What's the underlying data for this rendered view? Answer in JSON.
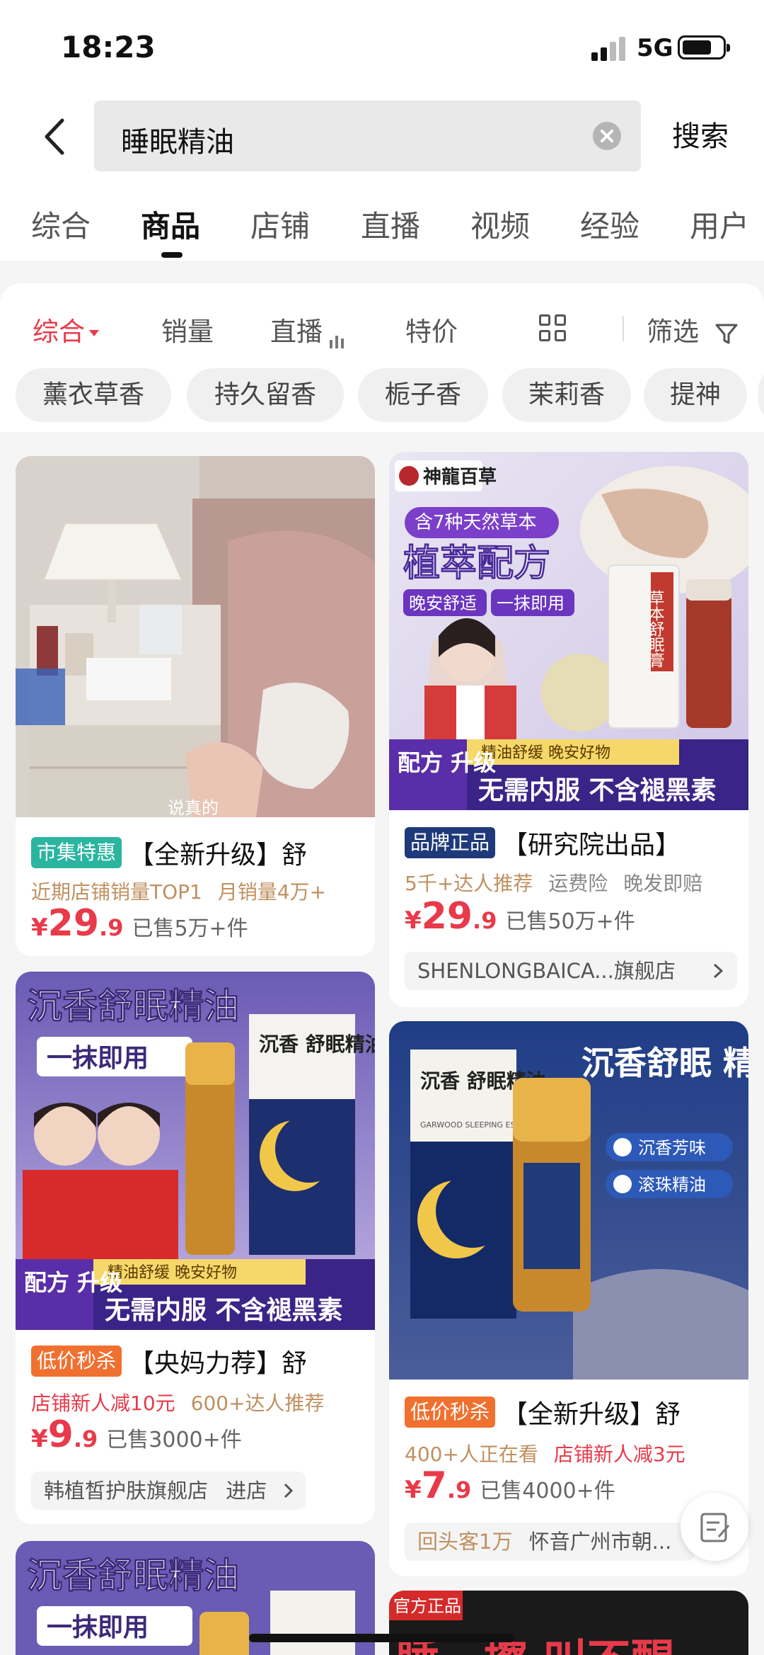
{
  "status_bar": {
    "time": "18:23",
    "network": "5G"
  },
  "search": {
    "query": "睡眠精油",
    "search_button": "搜索"
  },
  "main_tabs": [
    "综合",
    "商品",
    "店铺",
    "直播",
    "视频",
    "经验",
    "用户"
  ],
  "active_main_tab": "商品",
  "sort_bar": {
    "comprehensive": "综合",
    "sales": "销量",
    "live": "直播",
    "special_price": "特价",
    "filter": "筛选"
  },
  "chips": [
    "薰衣草香",
    "持久留香",
    "栀子香",
    "茉莉香",
    "提神"
  ],
  "colors": {
    "accent_red": "#e83a4a",
    "badge_green": "#2bb5a0",
    "badge_navy": "#1f3a7a",
    "badge_orange": "#f07030"
  },
  "products": [
    {
      "badge": "市集特惠",
      "title": "【全新升级】舒",
      "info": [
        "近期店铺销量TOP1",
        "月销量4万+"
      ],
      "price_int": "29",
      "price_dec": ".9",
      "currency": "¥",
      "sold": "已售5万+件",
      "image_caption": "说真的"
    },
    {
      "badge": "品牌正品",
      "title": "【研究院出品】",
      "info": [
        "5千+达人推荐",
        "运费险",
        "晚发即赔"
      ],
      "price_int": "29",
      "price_dec": ".9",
      "currency": "¥",
      "sold": "已售50万+件",
      "store": "SHENLONGBAICA...旗舰店",
      "image": {
        "brand": "神龍百草",
        "pill": "含7种天然草本",
        "headline": "植萃配方",
        "tags": [
          "晚安舒适",
          "一抹即用"
        ],
        "product_name": "草本舒眠膏",
        "band_small": "精油舒缓 晚安好物",
        "band_left": "配方 升级",
        "band_right": "无需内服 不含褪黑素"
      }
    },
    {
      "badge": "低价秒杀",
      "title": "【央妈力荐】舒",
      "info": [
        "店铺新人减10元",
        "600+达人推荐"
      ],
      "price_int": "9",
      "price_dec": ".9",
      "currency": "¥",
      "sold": "已售3000+件",
      "store": "韩植皙护肤旗舰店",
      "store_action": "进店",
      "image": {
        "headline": "沉香舒眠精油",
        "pill": "一抹即用",
        "box_name": "沉香 舒眠精油",
        "band_small": "精油舒缓 晚安好物",
        "band_left": "配方 升级",
        "band_right": "无需内服 不含褪黑素"
      }
    },
    {
      "badge": "低价秒杀",
      "title": "【全新升级】舒",
      "info": [
        "400+人正在看",
        "店铺新人减3元"
      ],
      "price_int": "7",
      "price_dec": ".9",
      "currency": "¥",
      "sold": "已售4000+件",
      "store": "回头客1万",
      "store_extra": "怀音广州市朝...",
      "image": {
        "headline": "沉香舒眠 精油",
        "box_name": "沉香 舒眠精油",
        "box_sub": "GARWOOD SLEEPING ESSENTIAL OIL",
        "checks": [
          "沉香芳味",
          "滚珠精油"
        ]
      }
    },
    {
      "image": {
        "headline": "沉香舒眠精油",
        "pill": "一抹即用"
      }
    },
    {
      "image": {
        "corner": "官方正品",
        "headline": "睡一擦 叫不醒"
      }
    }
  ]
}
